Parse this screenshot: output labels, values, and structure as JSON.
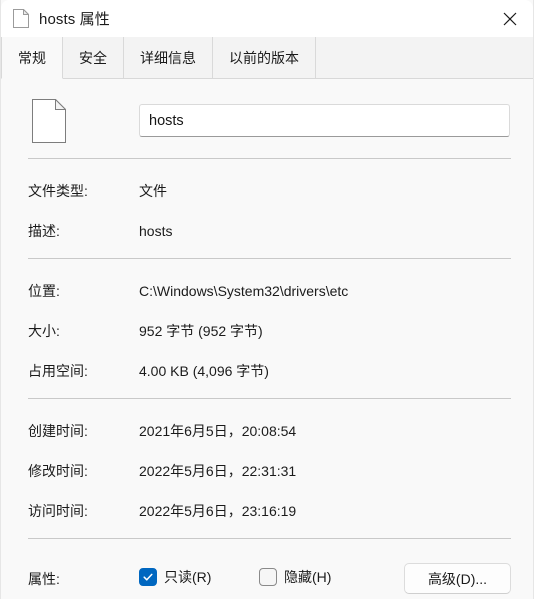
{
  "window": {
    "title": "hosts 属性",
    "title_icon": "document-icon",
    "close_label": "✕"
  },
  "tabs": [
    {
      "label": "常规",
      "active": true
    },
    {
      "label": "安全",
      "active": false
    },
    {
      "label": "详细信息",
      "active": false
    },
    {
      "label": "以前的版本",
      "active": false
    }
  ],
  "general": {
    "file_icon": "blank-document-icon",
    "filename_value": "hosts",
    "filename_placeholder": "",
    "rows": [
      {
        "label": "文件类型:",
        "value": "文件"
      },
      {
        "label": "描述:",
        "value": "hosts"
      },
      {
        "label": "位置:",
        "value": "C:\\Windows\\System32\\drivers\\etc"
      },
      {
        "label": "大小:",
        "value": "952 字节 (952 字节)"
      },
      {
        "label": "占用空间:",
        "value": "4.00 KB (4,096 字节)"
      },
      {
        "label": "创建时间:",
        "value": "2021年6月5日，20:08:54"
      },
      {
        "label": "修改时间:",
        "value": "2022年5月6日，22:31:31"
      },
      {
        "label": "访问时间:",
        "value": "2022年5月6日，23:16:19"
      }
    ],
    "attributes": {
      "label": "属性:",
      "readonly_label": "只读(R)",
      "readonly_checked": true,
      "hidden_label": "隐藏(H)",
      "hidden_checked": false,
      "advanced_label": "高级(D)..."
    }
  },
  "colors": {
    "accent": "#0067C0",
    "window_bg": "#F9F9F9",
    "titlebar_bg": "#FFFFFF",
    "tabstrip_bg": "#F3F3F3",
    "divider": "#C9C9C9"
  }
}
